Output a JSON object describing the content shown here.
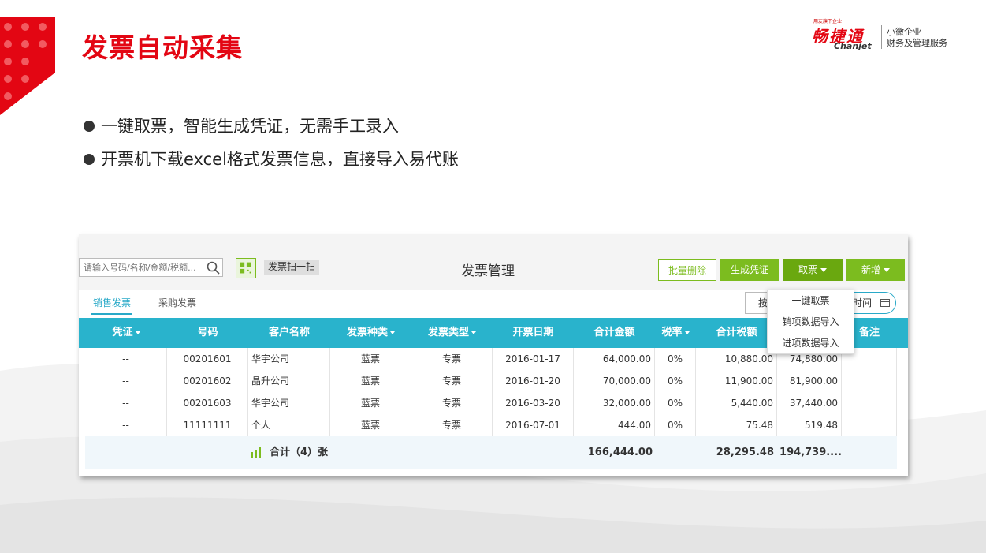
{
  "slide": {
    "title": "发票自动采集",
    "bullets": [
      "一键取票，智能生成凭证，无需手工录入",
      "开票机下载excel格式发票信息，直接导入易代账"
    ]
  },
  "logo": {
    "tagline": "用友旗下企业",
    "cn": "畅捷通",
    "en": "Chanjet",
    "line1": "小微企业",
    "line2": "财务及管理服务"
  },
  "app": {
    "search_placeholder": "请输入号码/名称/金额/税额...",
    "scan_label": "发票扫一扫",
    "title": "发票管理",
    "buttons": {
      "batch_delete": "批量删除",
      "generate_voucher": "生成凭证",
      "fetch": "取票",
      "add": "新增"
    },
    "tabs": {
      "sales": "销售发票",
      "purchase": "采购发票"
    },
    "filter_by": "按",
    "time_filter": "时间",
    "dropdown": [
      "一键取票",
      "销项数据导入",
      "进项数据导入"
    ],
    "columns": [
      "凭证",
      "号码",
      "客户名称",
      "发票种类",
      "发票类型",
      "开票日期",
      "合计金额",
      "税率",
      "合计税额",
      "",
      "备注"
    ],
    "rows": [
      {
        "voucher": "--",
        "number": "00201601",
        "customer": "华宇公司",
        "kind": "蓝票",
        "type": "专票",
        "date": "2016-01-17",
        "amount": "64,000.00",
        "rate": "0%",
        "tax": "10,880.00",
        "total": "74,880.00",
        "note": ""
      },
      {
        "voucher": "--",
        "number": "00201602",
        "customer": "晶升公司",
        "kind": "蓝票",
        "type": "专票",
        "date": "2016-01-20",
        "amount": "70,000.00",
        "rate": "0%",
        "tax": "11,900.00",
        "total": "81,900.00",
        "note": ""
      },
      {
        "voucher": "--",
        "number": "00201603",
        "customer": "华宇公司",
        "kind": "蓝票",
        "type": "专票",
        "date": "2016-03-20",
        "amount": "32,000.00",
        "rate": "0%",
        "tax": "5,440.00",
        "total": "37,440.00",
        "note": ""
      },
      {
        "voucher": "--",
        "number": "11111111",
        "customer": "个人",
        "kind": "蓝票",
        "type": "专票",
        "date": "2016-07-01",
        "amount": "444.00",
        "rate": "0%",
        "tax": "75.48",
        "total": "519.48",
        "note": ""
      }
    ],
    "totals": {
      "label": "合计（4）张",
      "amount": "166,444.00",
      "tax": "28,295.48",
      "total": "194,739...."
    }
  },
  "colors": {
    "brand_red": "#e30613",
    "header_teal": "#29b3cc",
    "accent_green": "#7cbc1f",
    "tab_blue": "#29a9c8"
  }
}
